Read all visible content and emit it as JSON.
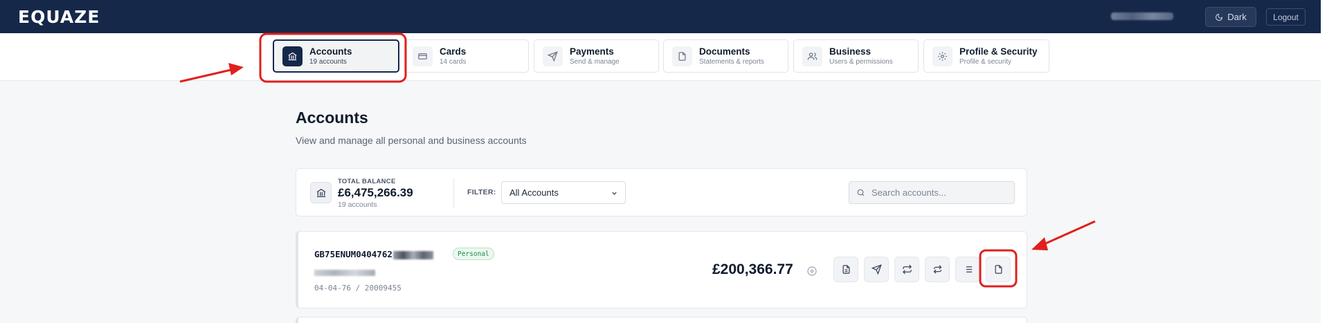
{
  "brand": {
    "logo": "EQUAZE"
  },
  "header": {
    "theme_button": "Dark",
    "logout_button": "Logout"
  },
  "tabs": [
    {
      "title": "Accounts",
      "subtitle": "19 accounts",
      "icon": "bank-icon",
      "active": true
    },
    {
      "title": "Cards",
      "subtitle": "14 cards",
      "icon": "card-icon",
      "active": false
    },
    {
      "title": "Payments",
      "subtitle": "Send & manage",
      "icon": "send-icon",
      "active": false
    },
    {
      "title": "Documents",
      "subtitle": "Statements & reports",
      "icon": "document-icon",
      "active": false
    },
    {
      "title": "Business",
      "subtitle": "Users & permissions",
      "icon": "users-icon",
      "active": false
    },
    {
      "title": "Profile & Security",
      "subtitle": "Profile & security",
      "icon": "gear-icon",
      "active": false
    }
  ],
  "page": {
    "title": "Accounts",
    "subtitle": "View and manage all personal and business accounts"
  },
  "summary": {
    "label": "TOTAL BALANCE",
    "total": "£6,475,266.39",
    "count": "19 accounts",
    "filter_label": "FILTER:",
    "filter_value": "All Accounts",
    "search_placeholder": "Search accounts..."
  },
  "account": {
    "iban": "GB75ENUM0404762",
    "badge": "Personal",
    "sort_and_number": "04-04-76 / 20009455",
    "balance": "£200,366.77",
    "actions": [
      "file-text-icon",
      "send-icon",
      "transfer-icon",
      "exchange-icon",
      "list-icon",
      "document-icon"
    ]
  },
  "annotations": {
    "color": "#e0201c"
  },
  "colors": {
    "navy": "#15284a",
    "accent_green": "#1f8a4a"
  }
}
